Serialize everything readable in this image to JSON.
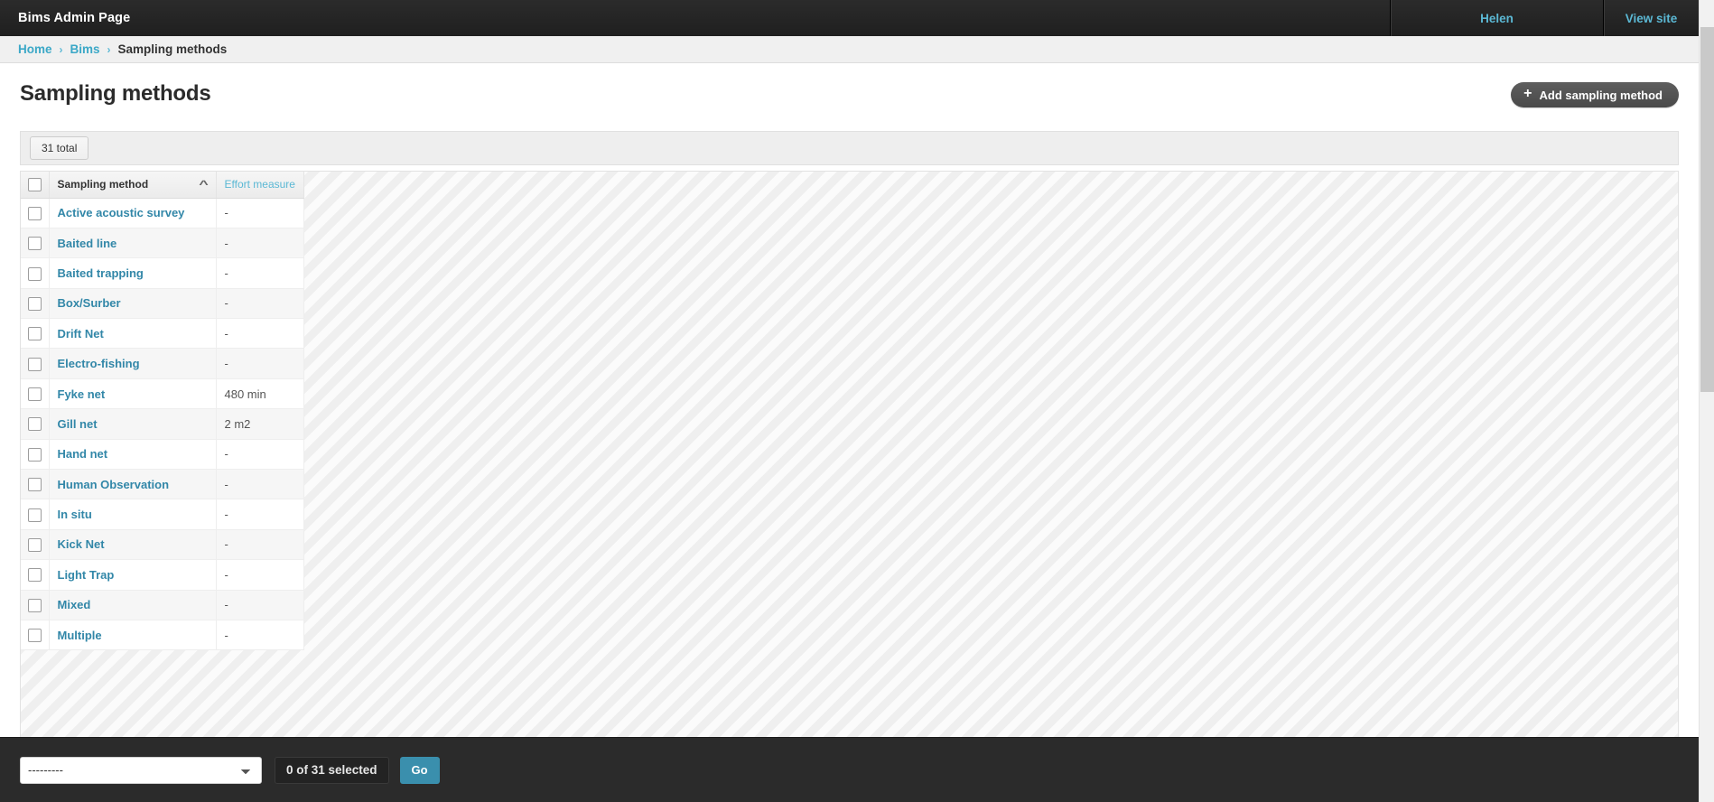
{
  "topnav": {
    "brand": "Bims Admin Page",
    "user_link": "Helen",
    "view_site_link": "View site"
  },
  "breadcrumbs": {
    "items": [
      {
        "label": "Home",
        "is_link": true
      },
      {
        "label": "Bims",
        "is_link": true
      },
      {
        "label": "Sampling methods",
        "is_link": false
      }
    ],
    "separator": "›"
  },
  "page": {
    "title": "Sampling methods",
    "add_button_label": "Add sampling method",
    "add_button_icon": "plus-icon",
    "total_badge": "31 total"
  },
  "table": {
    "select_all_name": "select-all-checkbox",
    "columns": [
      {
        "key": "check",
        "label": ""
      },
      {
        "key": "name",
        "label": "Sampling method",
        "sorted": true,
        "sort_direction": "asc",
        "sort_icon": "chevron-up-icon"
      },
      {
        "key": "effort",
        "label": "Effort measure",
        "sorted": false
      }
    ],
    "rows": [
      {
        "name": "Active acoustic survey",
        "effort": "-"
      },
      {
        "name": "Baited line",
        "effort": "-"
      },
      {
        "name": "Baited trapping",
        "effort": "-"
      },
      {
        "name": "Box/Surber",
        "effort": "-"
      },
      {
        "name": "Drift Net",
        "effort": "-"
      },
      {
        "name": "Electro-fishing",
        "effort": "-"
      },
      {
        "name": "Fyke net",
        "effort": "480 min"
      },
      {
        "name": "Gill net",
        "effort": "2 m2"
      },
      {
        "name": "Hand net",
        "effort": "-"
      },
      {
        "name": "Human Observation",
        "effort": "-"
      },
      {
        "name": "In situ",
        "effort": "-"
      },
      {
        "name": "Kick Net",
        "effort": "-"
      },
      {
        "name": "Light Trap",
        "effort": "-"
      },
      {
        "name": "Mixed",
        "effort": "-"
      },
      {
        "name": "Multiple",
        "effort": "-"
      }
    ]
  },
  "actions": {
    "select_value": "---------",
    "options": [
      "---------"
    ],
    "selection_count": "0 of 31 selected",
    "go_label": "Go"
  },
  "colors": {
    "link": "#3287a8",
    "nav_link": "#5bb8d4",
    "topnav_bg": "#2b2b2b",
    "go_button": "#3a8fad",
    "add_button": "#4f4f4f"
  }
}
